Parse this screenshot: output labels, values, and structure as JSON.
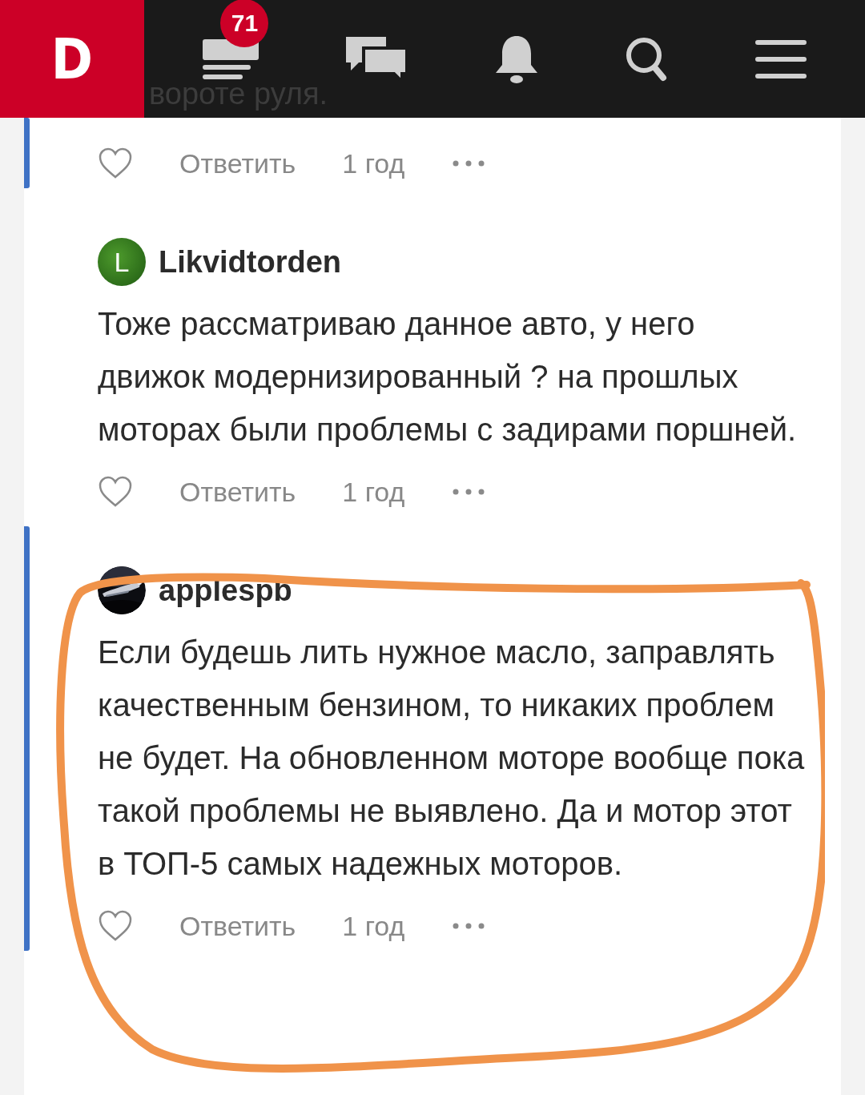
{
  "header": {
    "logo": "D",
    "badge": "71",
    "behind_text": "вороте руля."
  },
  "comments": [
    {
      "highlighted": true,
      "liked": false,
      "reply": "Ответить",
      "time": "1 год"
    },
    {
      "author": "Likvidtorden",
      "avatar": {
        "kind": "letter",
        "letter": "L"
      },
      "text": "Тоже рассматриваю данное авто, у него движок модернизированный ? на прошлых моторах были проблемы с задирами поршней.",
      "highlighted": false,
      "liked": false,
      "reply": "Ответить",
      "time": "1 год"
    },
    {
      "author": "applespb",
      "text": "Если будешь лить нужное масло, заправлять качественным бензином, то никаких проблем не будет. На обновленном моторе вообще пока такой проблемы не выявлено. Да и мотор этот в ТОП-5 самых надежных моторов.",
      "highlighted": true,
      "liked": false,
      "reply": "Ответить",
      "time": "1 год"
    }
  ]
}
